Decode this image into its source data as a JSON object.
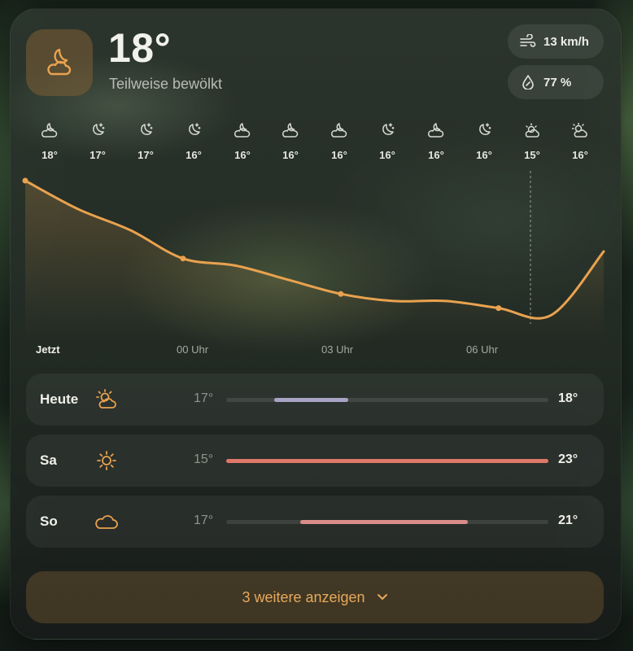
{
  "current": {
    "temperature": "18°",
    "condition": "Teilweise bewölkt",
    "icon": "moon-cloud-icon",
    "wind": "13 km/h",
    "humidity": "77 %"
  },
  "hourly": [
    {
      "icon": "moon-cloud-icon",
      "temp": "18°"
    },
    {
      "icon": "moon-stars-icon",
      "temp": "17°"
    },
    {
      "icon": "moon-stars-icon",
      "temp": "17°"
    },
    {
      "icon": "moon-stars-icon",
      "temp": "16°"
    },
    {
      "icon": "moon-cloud-icon",
      "temp": "16°"
    },
    {
      "icon": "moon-cloud-icon",
      "temp": "16°"
    },
    {
      "icon": "moon-cloud-icon",
      "temp": "16°"
    },
    {
      "icon": "moon-stars-icon",
      "temp": "16°"
    },
    {
      "icon": "moon-cloud-icon",
      "temp": "16°"
    },
    {
      "icon": "moon-stars-icon",
      "temp": "16°"
    },
    {
      "icon": "sunrise-cloud-icon",
      "temp": "15°"
    },
    {
      "icon": "sun-cloud-icon",
      "temp": "16°"
    }
  ],
  "time_labels": [
    "Jetzt",
    "00 Uhr",
    "03 Uhr",
    "06 Uhr"
  ],
  "chart_data": {
    "type": "line",
    "x": [
      "Jetzt",
      "",
      "",
      "00 Uhr",
      "",
      "",
      "03 Uhr",
      "",
      "",
      "06 Uhr",
      "",
      ""
    ],
    "values": [
      18,
      17.6,
      17.3,
      16.9,
      16.8,
      16.6,
      16.4,
      16.3,
      16.3,
      16.2,
      16.1,
      17.0
    ],
    "accent_color": "#e9a24f"
  },
  "daily": [
    {
      "day": "Heute",
      "icon": "sun-cloud-icon",
      "low": "17°",
      "high": "18°",
      "range_start": 0.15,
      "range_end": 0.38,
      "bar_color": "#a9a3c4"
    },
    {
      "day": "Sa",
      "icon": "sun-icon",
      "low": "15°",
      "high": "23°",
      "range_start": 0.0,
      "range_end": 1.0,
      "bar_color": "#e0786a"
    },
    {
      "day": "So",
      "icon": "cloud-icon",
      "low": "17°",
      "high": "21°",
      "range_start": 0.23,
      "range_end": 0.75,
      "bar_color": "#d98c88"
    }
  ],
  "more_button": {
    "label": "3 weitere anzeigen"
  },
  "colors": {
    "accent": "#e9a24f"
  }
}
